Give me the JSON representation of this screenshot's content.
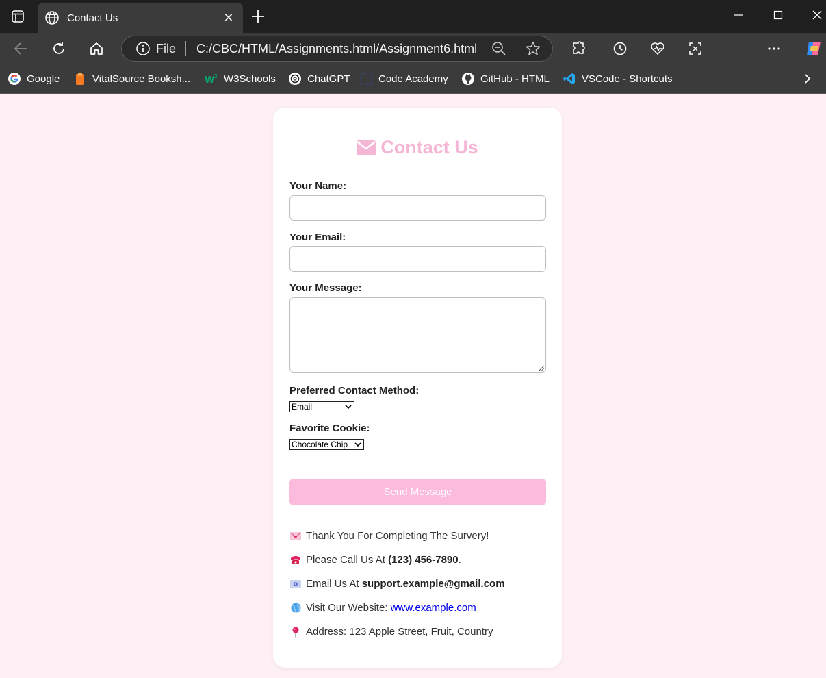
{
  "browser": {
    "tab_title": "Contact Us",
    "address": {
      "scheme": "File",
      "url": "C:/CBC/HTML/Assignments.html/Assignment6.html"
    },
    "bookmarks": [
      {
        "label": "Google",
        "icon": "google-icon"
      },
      {
        "label": "VitalSource Booksh...",
        "icon": "vitalsource-icon"
      },
      {
        "label": "W3Schools",
        "icon": "w3schools-icon"
      },
      {
        "label": "ChatGPT",
        "icon": "chatgpt-icon"
      },
      {
        "label": "Code Academy",
        "icon": "codeacademy-icon"
      },
      {
        "label": "GitHub - HTML",
        "icon": "github-icon"
      },
      {
        "label": "VSCode - Shortcuts",
        "icon": "vscode-icon"
      }
    ]
  },
  "form": {
    "title": "Contact Us",
    "name_label": "Your Name:",
    "name_value": "",
    "email_label": "Your Email:",
    "email_value": "",
    "message_label": "Your Message:",
    "message_value": "",
    "method_label": "Preferred Contact Method:",
    "method_selected": "Email",
    "cookie_label": "Favorite Cookie:",
    "cookie_selected": "Chocolate Chip",
    "submit_label": "Send Message"
  },
  "info": {
    "thanks": "Thank You For Completing The Survery!",
    "call_prefix": "Please Call Us At ",
    "phone": "(123) 456-7890",
    "call_suffix": ".",
    "email_prefix": "Email Us At ",
    "email": "support.example@gmail.com",
    "website_prefix": "Visit Our Website: ",
    "website": "www.example.com",
    "address": "Address: 123 Apple Street, Fruit, Country"
  },
  "colors": {
    "page_bg": "#fff0f5",
    "accent_pink": "#f5b6d6",
    "button_pink": "#fcbadd",
    "link": "#0000ee"
  }
}
